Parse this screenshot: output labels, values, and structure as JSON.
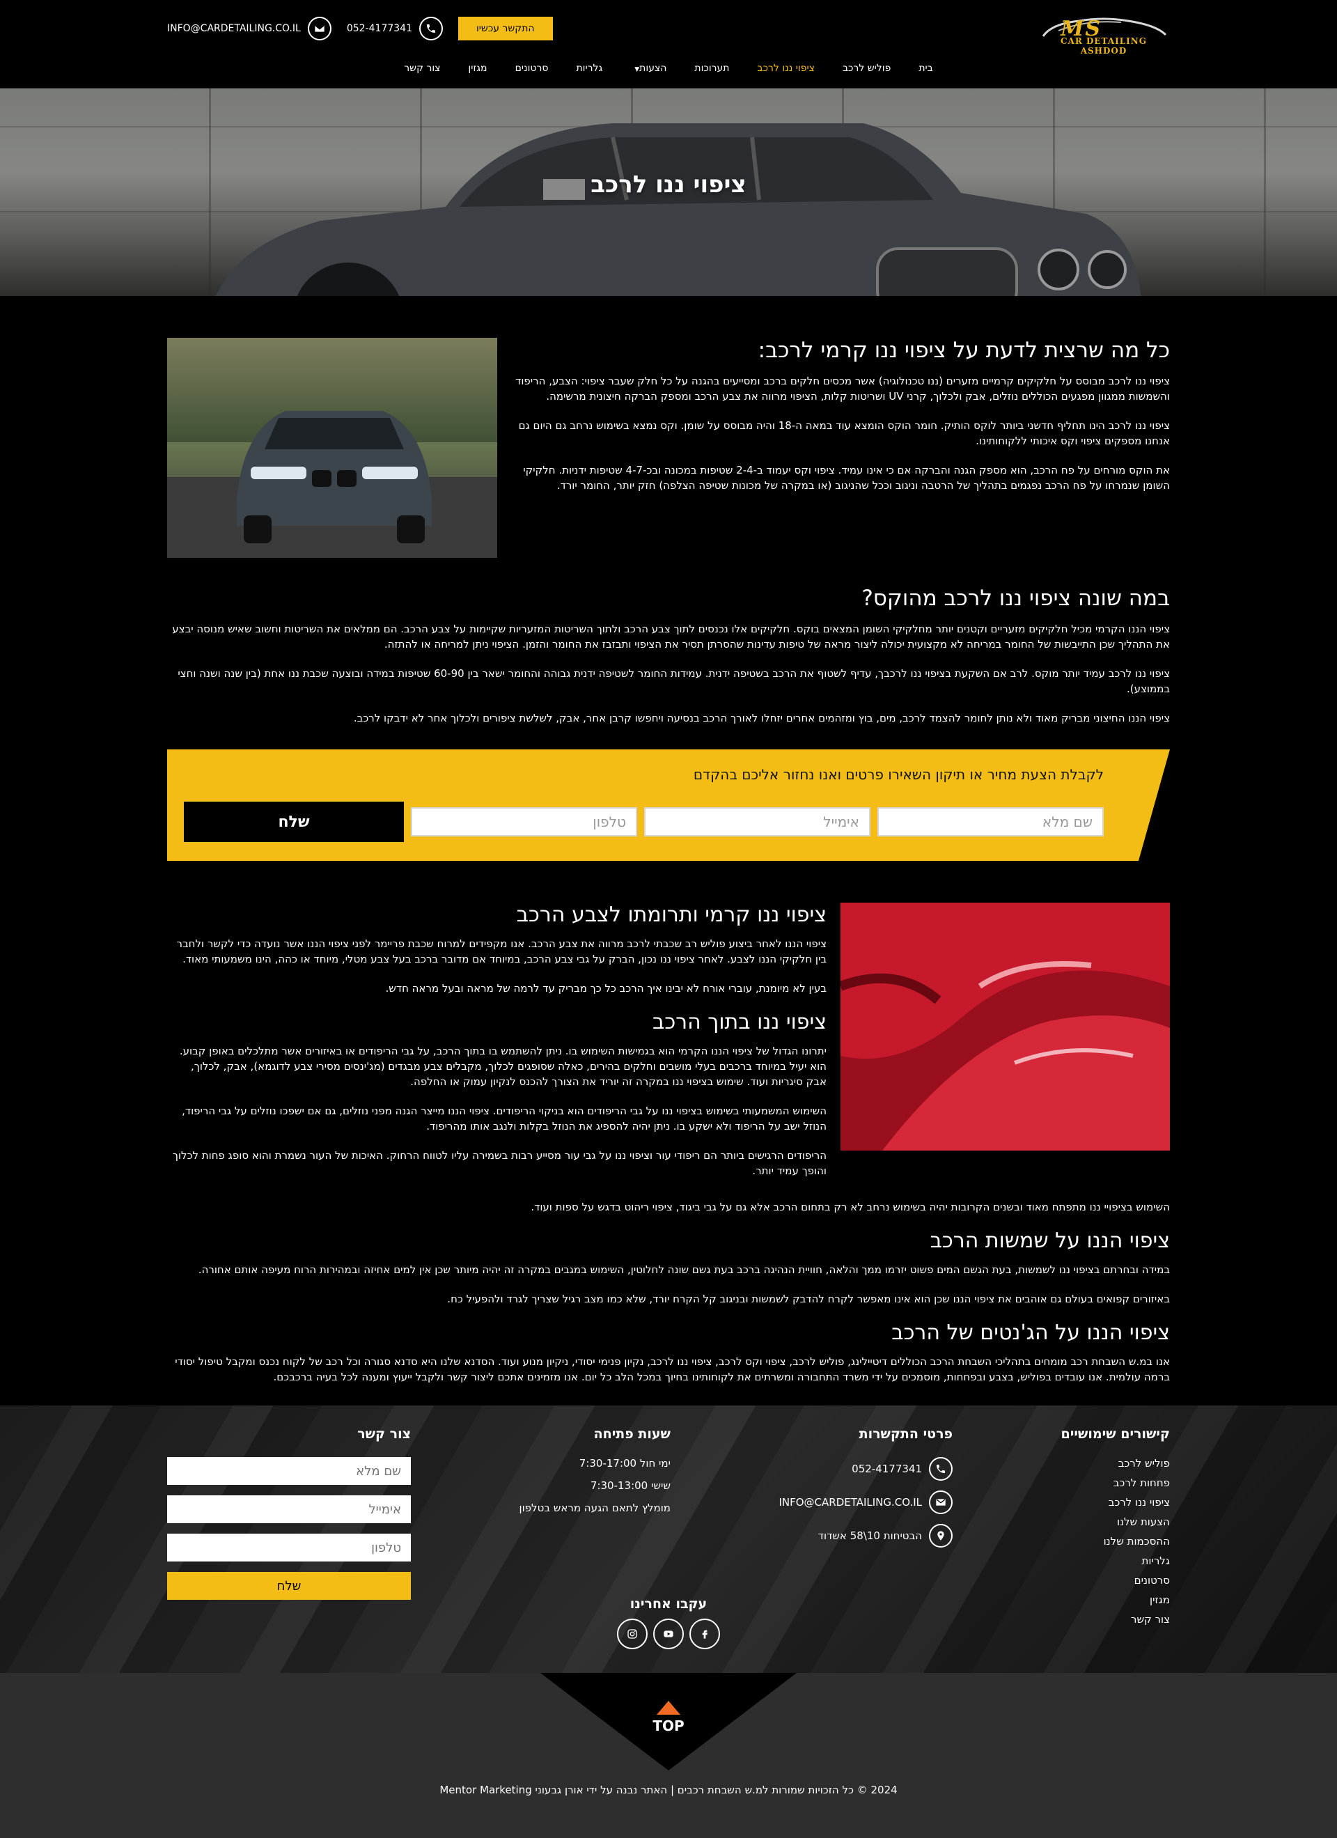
{
  "header": {
    "logo": {
      "ms": "MS",
      "sub": "CAR DETAILING ASHDOD"
    },
    "cta_label": "התקשר עכשיו",
    "phone": "052-4177341",
    "email": "INFO@CARDETAILING.CO.IL",
    "nav": [
      {
        "label": "בית"
      },
      {
        "label": "פוליש לרכב"
      },
      {
        "label": "ציפוי ננו לרכב"
      },
      {
        "label": "תערוכות"
      },
      {
        "label": "הצעות"
      },
      {
        "label": "גלריות"
      },
      {
        "label": "סרטונים"
      },
      {
        "label": "מגזין"
      },
      {
        "label": "צור קשר"
      }
    ]
  },
  "hero": {
    "title": "ציפוי ננו לרכב"
  },
  "section1": {
    "title": "כל מה שרצית לדעת על ציפוי ננו קרמי לרכב:",
    "p1": "ציפוי ננו לרכב מבוסס על חלקיקים קרמיים מזערים (ננו טכנולוגיה) אשר מכסים חלקים ברכב ומסייעים בהגנה על כל חלק שעבר ציפוי: הצבע, הריפוד והשמשות ממגוון מפגעים הכוללים נוזלים, אבק ולכלוך, קרני UV ושריטות קלות, הציפוי מרווה את צבע הרכב ומספק הברקה חיצונית מרשימה.",
    "p2": "ציפוי ננו לרכב הינו תחליף חדשני ביותר לוקס הותיק. חומר הוקס הומצא עוד במאה ה-18 והיה מבוסס על שומן. וקס נמצא בשימוש נרחב גם היום גם אנחנו מספקים ציפוי וקס איכותי ללקוחותינו.",
    "p3": "את הוקס מורחים על פח הרכב, הוא מספק הגנה והברקה אם כי אינו עמיד. ציפוי וקס יעמוד ב-2-4 שטיפות במכונה ובכ-4-7 שטיפות ידניות. חלקיקי השומן שנמרחו על פח הרכב נפגמים בתהליך של הרטבה וניגוב וככל שהניגוב (או במקרה של מכונות שטיפה הצלפה) חזק יותר, החומר יורד."
  },
  "section2": {
    "title": "במה שונה ציפוי ננו לרכב מהוקס?",
    "p1": "ציפוי הננו הקרמי מכיל חלקיקים מזעריים וקטנים יותר מחלקיקי השומן המצאים בוקס. חלקיקים אלו נכנסים לתוך צבע הרכב ולתוך השריטות המזעריות שקיימות על צבע הרכב. הם ממלאים את השריטות וחשוב שאיש מנוסה יבצע את התהליך שכן התייבשות של החומר במריחה לא מקצועית יכולה ליצור מראה של טיפות עדינות שהסרתן תסיר את הציפוי ותבזבז את החומר והזמן. הציפוי ניתן למריחה או להתזה.",
    "p2": "ציפוי ננו לרכב עמיד יותר מוקס. לרב אם השקעת בציפוי ננו לרכבך, עדיף לשטוף את הרכב בשטיפה ידנית. עמידות החומר לשטיפה ידנית גבוהה והחומר ישאר בין 60-90 שטיפות במידה ובוצעה שכבת ננו אחת (בין שנה ושנה וחצי בממוצע).",
    "p3": "ציפוי הננו החיצוני מבריק מאוד ולא נותן לחומר להצמד לרכב, מים, בוץ ומזהמים אחרים יזחלו לאורך הרכב בנסיעה ויחפשו קרבן אחר, אבק, לשלשת ציפורים ולכלוך אחר לא ידבקו לרכב."
  },
  "form_banner": {
    "title": "לקבלת הצעת מחיר או תיקון השאירו פרטים ואנו נחזור אליכם בהקדם",
    "name_placeholder": "שם מלא",
    "email_placeholder": "אימייל",
    "phone_placeholder": "טלפון",
    "submit": "שלח"
  },
  "section3": {
    "title": "ציפוי ננו קרמי ותרומתו לצבע הרכב",
    "p1": "ציפוי הננו לאחר ביצוע פוליש רב שכבתי לרכב מרווה את צבע הרכב. אנו מקפידים למרוח שכבת פריימר לפני ציפוי הננו אשר נועדה כדי לקשר ולחבר בין חלקיקי הננו לצבע. לאחר ציפוי ננו נכון, הברק על גבי צבע הרכב, במיוחד אם מדובר ברכב בעל צבע מטלי, מיוחד או כהה, הינו משמעותי מאוד.",
    "p2": "בעין לא מיומנת, עוברי אורח לא יבינו איך הרכב כל כך מבריק עד לרמה של מראה ובעל מראה חדש.",
    "title2": "ציפוי ננו בתוך הרכב",
    "p3": "יתרונו הגדול של ציפוי הננו הקרמי הוא בגמישות השימוש בו. ניתן להשתמש בו בתוך הרכב, על גבי הריפודים או באיזורים אשר מתלכלים באופן קבוע. הוא יעיל במיוחד ברכבים בעלי מושבים וחלקים בהירים, כאלה שסופגים לכלוך, מקבלים צבע מבגדים (מג'ינסים מסירי צבע לדוגמא), אבק, לכלוך, אבק סיגריות ועוד. שימוש בציפוי ננו במקרה זה יוריד את הצורך להכנס לנקיון עמוק או החלפה.",
    "p4": "השימוש המשמעותי בשימוש בציפוי ננו על גבי הריפודים הוא בניקוי הריפודים. ציפוי הננו מייצר הגנה מפני נוזלים, גם אם ישפכו נוזלים על גבי הריפוד, הנוזל ישב על הריפוד ולא ישקע בו. ניתן יהיה להספיג את הנוזל בקלות ולנגב אותו מהריפוד.",
    "p5": "הריפודים הרגישים ביותר הם ריפודי עור וציפוי ננו על גבי עור מסייע רבות בשמירה עליו לטווח הרחוק. האיכות של העור נשמרת והוא סופג פחות לכלוך והופך עמיד יותר.",
    "p6": "השימוש בציפויי ננו מתפתח מאוד ובשנים הקרובות יהיה בשימוש נרחב לא רק בתחום הרכב אלא גם על גבי ביגוד, ציפוי ריהוט בדגש על ספות ועוד."
  },
  "section4": {
    "title": "ציפוי הננו על שמשות הרכב",
    "p1": "במידה ובחרתם בציפוי ננו לשמשות, בעת הגשם המים פשוט יזרמו ממך והלאה, חוויית הנהיגה ברכב בעת גשם שונה לחלוטין, השימוש במגבים במקרה זה יהיה מיותר שכן אין למים אחיזה ובמהירות הרוח מעיפה אותם אחורה.",
    "p2": "באיזורים קפואים בעולם גם אוהבים את ציפוי הננו שכן הוא אינו מאפשר לקרח להדבק לשמשות ובניגוב קל הקרח יורד, שלא כמו מצב רגיל שצריך לגרד ולהפעיל כח."
  },
  "section5": {
    "title": "ציפוי הננו על הג'נטים של הרכב",
    "p1": "אנו במ.ש השבחת רכב מומחים בתהליכי השבחת הרכב הכוללים דיטיילינג, פוליש לרכב, ציפוי וקס לרכב, ציפוי ננו לרכב, נקיון פנימי יסודי, ניקיון מנוע ועוד. הסדנא שלנו היא סדנא סגורה וכל רכב של לקוח נכנס ומקבל טיפול יסודי ברמה עולמית. אנו עובדים בפוליש, בצבע ובפחחות, מוסמכים על ידי משרד התחבורה ומשרתים את לקוחותינו בחיוך במכל הלב כל יום. אנו מזמינים אתכם ליצור קשר ולקבל ייעוץ ומענה לכל בעיה ברכבכם."
  },
  "footer": {
    "links_title": "קישורים שימושיים",
    "links": [
      "פוליש לרכב",
      "פחחות לרכב",
      "ציפוי ננו לרכב",
      "הצעות שלנו",
      "ההסכמות שלנו",
      "גלריות",
      "סרטונים",
      "מגזין",
      "צור קשר"
    ],
    "contact_title": "פרטי התקשרות",
    "phone": "052-4177341",
    "email": "INFO@CARDETAILING.CO.IL",
    "address": "הבטיחות 10\\58 אשדוד",
    "hours_title": "שעות פתיחה",
    "hours": [
      "ימי חול 7:30-17:00",
      "שישי 7:30-13:00",
      "מומלץ לתאם הגעה מראש בטלפון"
    ],
    "form_title": "צור קשר",
    "name_placeholder": "שם מלא",
    "email_placeholder": "אימייל",
    "phone_placeholder": "טלפון",
    "submit": "שלח",
    "follow_title": "עקבו אחרינו",
    "top_label": "TOP",
    "copyright": "2024 © כל הזכויות שמורות למ.ש השבחת רכבים | האתר נבנה על ידי אורן גבעוני Mentor Marketing"
  },
  "colors": {
    "accent": "#f3bd16",
    "background": "#000000",
    "footer_bottom": "#2e2e2e",
    "top_arrow": "#f06a22"
  }
}
